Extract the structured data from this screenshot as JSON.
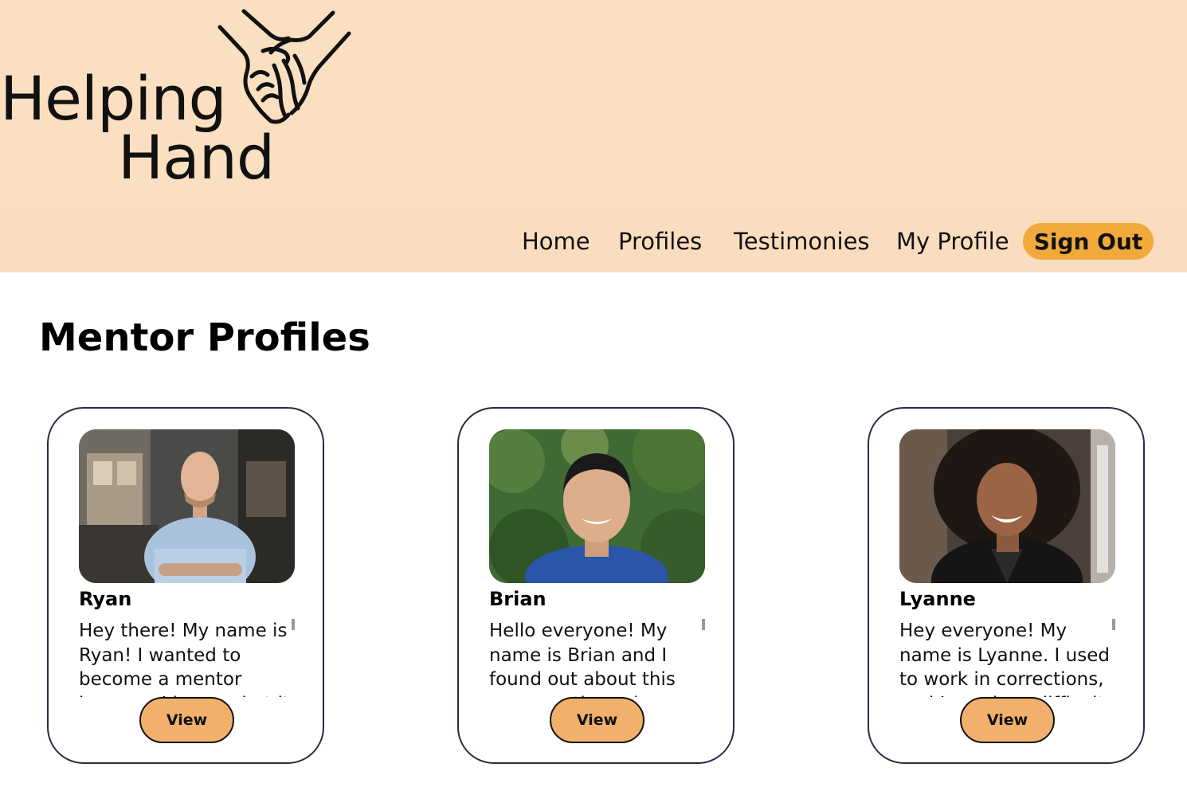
{
  "brand": {
    "line1": "Helping",
    "line2": "Hand",
    "icon": "holding-hands-icon"
  },
  "nav": {
    "items": [
      {
        "label": "Home"
      },
      {
        "label": "Profiles"
      },
      {
        "label": "Testimonies"
      },
      {
        "label": "My Profile"
      }
    ],
    "signout_label": "Sign Out"
  },
  "main": {
    "title": "Mentor Profiles",
    "cards": [
      {
        "name": "Ryan",
        "bio": "Hey there! My name is Ryan! I wanted to become a mentor because I know what it is like",
        "button_label": "View"
      },
      {
        "name": "Brian",
        "bio": "Hello everyone! My name is Brian and I found out about this program through",
        "button_label": "View"
      },
      {
        "name": "Lyanne",
        "bio": "Hey everyone! My name is Lyanne. I used to work in corrections, and I saw how difficult it",
        "button_label": "View"
      }
    ]
  },
  "colors": {
    "header_bg": "#fadfc0",
    "signout_bg": "#f2a93b",
    "view_btn_bg": "#f1b06b",
    "card_border": "#2a2a44"
  }
}
